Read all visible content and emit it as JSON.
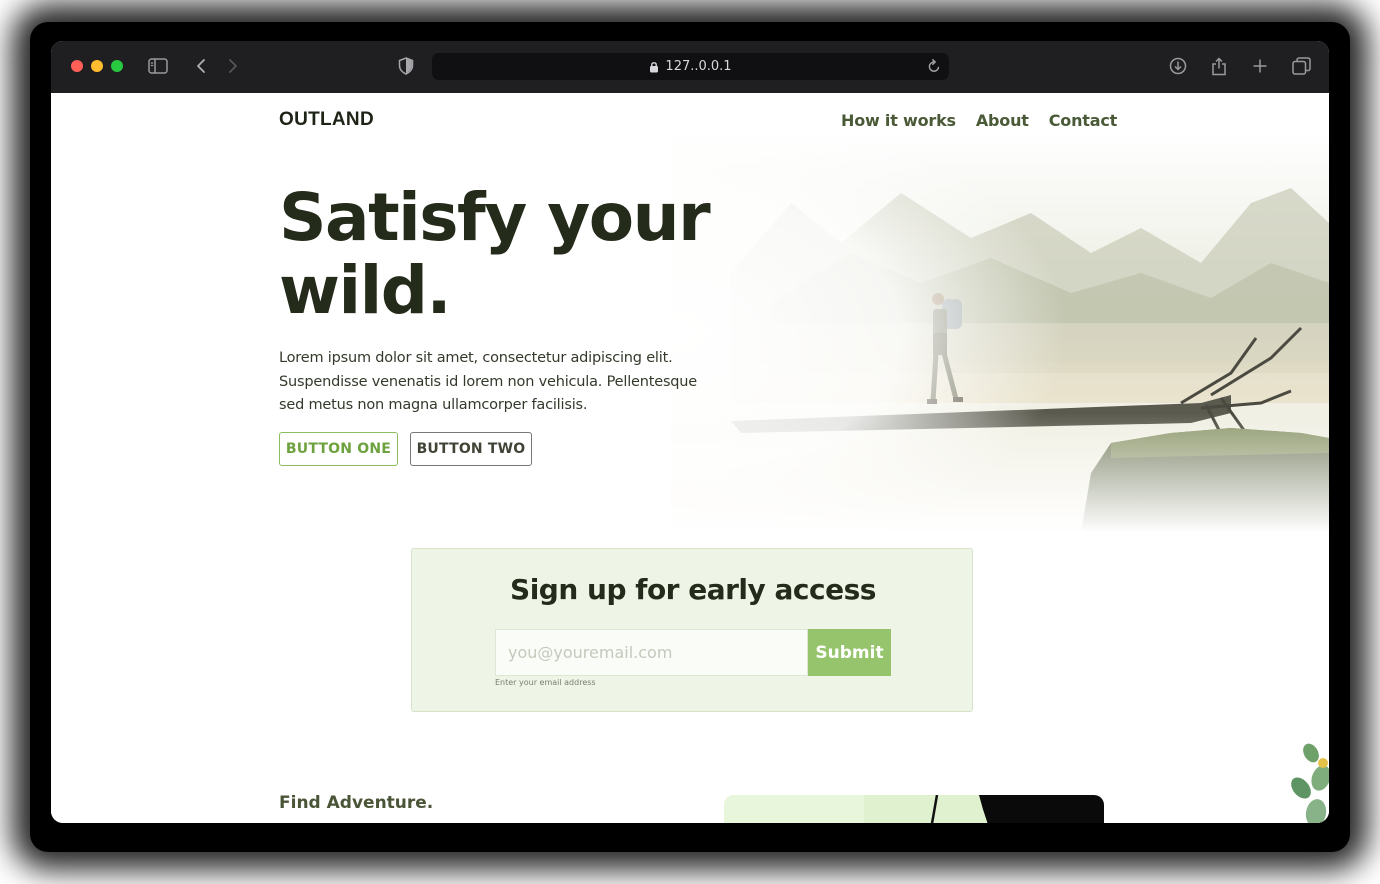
{
  "browser": {
    "url": "127..0.0.1",
    "icons": {
      "sidebar": "sidebar-icon",
      "back": "chevron-left-icon",
      "forward": "chevron-right-icon",
      "shield": "shield-icon",
      "lock": "lock-icon",
      "reload": "reload-icon",
      "download": "download-icon",
      "share": "share-icon",
      "new_tab": "plus-icon",
      "tabs": "tabs-overview-icon"
    }
  },
  "site": {
    "logo": "OUTLAND",
    "nav": [
      "How it works",
      "About",
      "Contact"
    ]
  },
  "hero": {
    "title_line1": "Satisfy your",
    "title_line2": "wild.",
    "text": "Lorem ipsum dolor sit amet, consectetur adipiscing elit. Suspendisse venenatis id lorem non vehicula. Pellentesque sed metus non magna ullamcorper facilisis.",
    "button_one": "BUTTON ONE",
    "button_two": "BUTTON TWO"
  },
  "signup": {
    "title": "Sign up for early access",
    "email_placeholder": "you@youremail.com",
    "submit": "Submit",
    "hint": "Enter your email address"
  },
  "section": {
    "heading": "Find Adventure."
  },
  "colors": {
    "accent_green": "#96c46c",
    "button_one_border": "#8cbf5c",
    "dark_text": "#252b1b",
    "nav_text": "#4a5a37",
    "signup_bg": "#eef5e6"
  }
}
